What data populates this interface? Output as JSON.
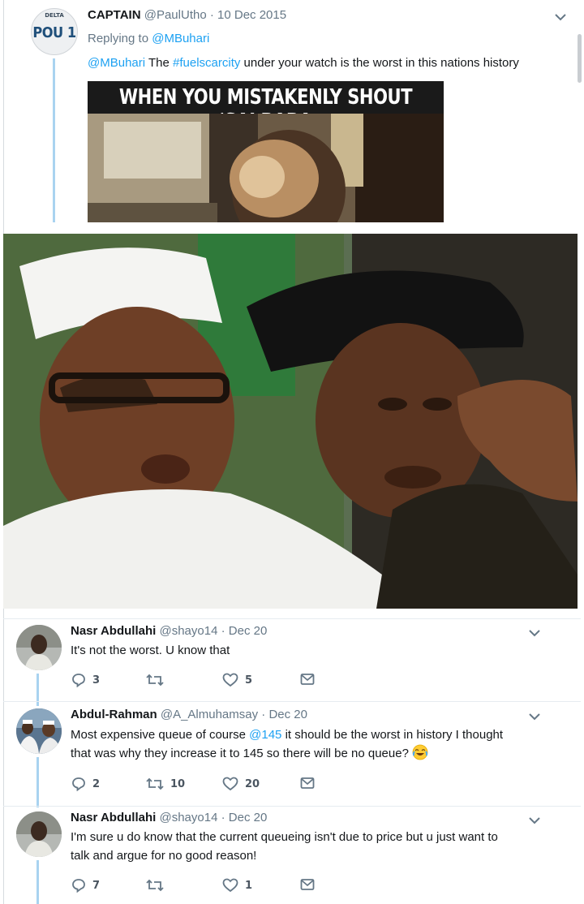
{
  "main_tweet": {
    "avatar": {
      "top_text": "DELTA",
      "text": "POU 1",
      "sub_text": ""
    },
    "display_name": "CAPTAIN",
    "handle": "@PaulUtho",
    "date": "10 Dec 2015",
    "separator": "·",
    "replying_label": "Replying to",
    "replying_to": "@MBuhari",
    "text_mention": "@MBuhari",
    "text_pre": " The ",
    "text_hashtag": "#fuelscarcity",
    "text_post": " under your watch is the worst in this nations history",
    "meme_caption": "WHEN YOU MISTAKENLY SHOUT 'SAI BABA"
  },
  "replies": [
    {
      "display_name": "Nasr Abdullahi",
      "handle": "@shayo14",
      "separator": "·",
      "date": "Dec 20",
      "text": "It's not the worst. U know that",
      "reply_count": "3",
      "retweet_count": "",
      "like_count": "5"
    },
    {
      "display_name": "Abdul-Rahman",
      "handle": "@A_Almuhamsay",
      "separator": "·",
      "date": "Dec 20",
      "text_line1_pre": "Most expensive queue of course ",
      "text_line1_mention": "@145",
      "text_line1_post": " it should be the worst in history I thought",
      "text_line2": "that was why they increase it to 145 so there will be no queue? ",
      "reply_count": "2",
      "retweet_count": "10",
      "like_count": "20"
    },
    {
      "display_name": "Nasr Abdullahi",
      "handle": "@shayo14",
      "separator": "·",
      "date": "Dec 20",
      "text_line1": "I'm sure u do know that the current queueing isn't due to price but u just want to",
      "text_line2": "talk and argue for no good reason!",
      "reply_count": "7",
      "retweet_count": "",
      "like_count": "1"
    }
  ],
  "colors": {
    "link": "#1da1f2",
    "secondary_text": "#657786",
    "thread_line": "#a9d3f0"
  },
  "icons": [
    "chevron-down-icon",
    "reply-icon",
    "retweet-icon",
    "like-icon",
    "message-icon",
    "joy-emoji-icon"
  ]
}
